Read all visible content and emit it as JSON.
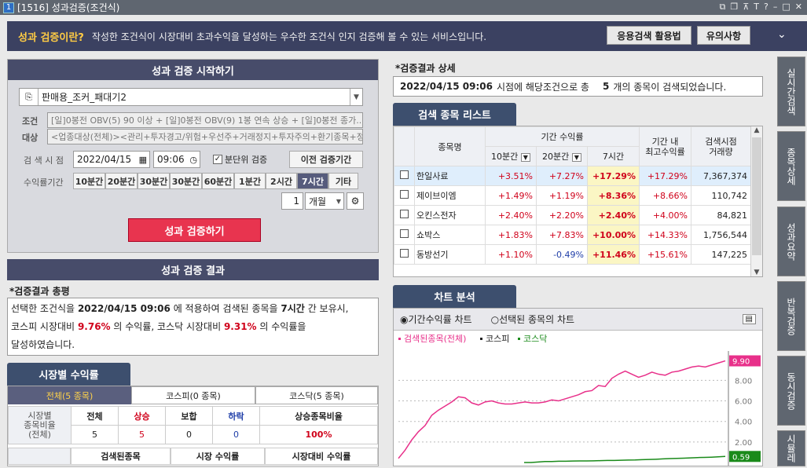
{
  "window": {
    "number": "1",
    "title": "[1516] 성과검증(조건식)"
  },
  "info": {
    "question": "성과 검증이란?",
    "desc": "작성한 조건식이 시장대비 초과수익을 달성하는 우수한 조건식 인지 검증해 볼 수 있는 서비스입니다.",
    "btn_apply": "응용검색 활용법",
    "btn_notes": "유의사항"
  },
  "start": {
    "header": "성과 검증 시작하기",
    "formula": "판매용_조커_패대기2",
    "cond_label1": "조건",
    "cond_label2": "대상",
    "cond_text": "[일]0봉전 OBV(5) 90 이상 + [일]0봉전 OBV(9) 1봉 연속 상승 + [일]0봉전 종가...",
    "target_text": "<업종대상(전체)><관리+투자경고/위험+우선주+거래정지+투자주의+환기종목+정",
    "time_label": "검 색 시 점",
    "date": "2022/04/15",
    "time": "09:06",
    "minute_check": "분단위 검증",
    "prev_btn": "이전 검증기간",
    "period_label": "수익률기간",
    "periods": [
      "10분간",
      "20분간",
      "30분간",
      "30분간",
      "60분간",
      "1분간",
      "2시간",
      "7시간",
      "기타"
    ],
    "count": "1",
    "unit": "개월",
    "run": "성과 검증하기"
  },
  "result": {
    "header": "성과 검증 결과",
    "summary_title": "*검증결과 총평",
    "line1a": "선택한 조건식을",
    "line1b": "2022/04/15 09:06",
    "line1c": "에 적용하여 검색된 종목을",
    "line1d": "7시간",
    "line1e": "간 보유시,",
    "line2a": "코스피 시장대비",
    "line2b": "9.76%",
    "line2c": "의 수익률, 코스닥 시장대비",
    "line2d": "9.31%",
    "line2e": "의 수익률을",
    "line3": "달성하였습니다."
  },
  "market": {
    "tab": "시장별 수익률",
    "subtabs": [
      "전체(5 종목)",
      "코스피(0 종목)",
      "코스닥(5 종목)"
    ],
    "rowlabel": "시장별\n종목비율\n(전체)",
    "headers": [
      "전체",
      "상승",
      "보합",
      "하락",
      "상승종목비율"
    ],
    "values": [
      "5",
      "5",
      "0",
      "0",
      "100%"
    ],
    "headers2": [
      "검색된종목",
      "시장 수익률",
      "시장대비 수익률"
    ]
  },
  "detail": {
    "title": "*검증결과 상세",
    "date": "2022/04/15 09:06",
    "t1": "시점에 해당조건으로 총",
    "count": "5",
    "t2": "개의 종목이 검색되었습니다."
  },
  "list": {
    "tab": "검색 종목 리스트",
    "h_name": "종목명",
    "h_period": "기간 수익률",
    "h_sub": [
      "10분간",
      "20분간",
      "7시간"
    ],
    "h_max": "기간 내\n최고수익률",
    "h_vol": "검색시점\n거래량",
    "rows": [
      {
        "name": "한일사료",
        "a": "+3.51%",
        "b": "+7.27%",
        "c": "+17.29%",
        "max": "+17.29%",
        "vol": "7,367,374"
      },
      {
        "name": "제이브이엠",
        "a": "+1.49%",
        "b": "+1.19%",
        "c": "+8.36%",
        "max": "+8.66%",
        "vol": "110,742"
      },
      {
        "name": "오킨스전자",
        "a": "+2.40%",
        "b": "+2.20%",
        "c": "+2.40%",
        "max": "+4.00%",
        "vol": "84,821"
      },
      {
        "name": "쇼박스",
        "a": "+1.83%",
        "b": "+7.83%",
        "c": "+10.00%",
        "max": "+14.33%",
        "vol": "1,756,544"
      },
      {
        "name": "동방선기",
        "a": "+1.10%",
        "b": "-0.49%",
        "c": "+11.46%",
        "max": "+15.61%",
        "vol": "147,225"
      }
    ]
  },
  "chart": {
    "tab": "차트 분석",
    "radio1": "기간수익률 차트",
    "radio2": "선택된 종목의 차트",
    "legend": [
      "검색된종목(전체)",
      "코스피",
      "코스닥"
    ],
    "colors": {
      "stock": "#e8308a",
      "kospi": "#222222",
      "kosdaq": "#1a8a1a"
    },
    "ticks": [
      "8.00",
      "6.00",
      "4.00",
      "2.00"
    ],
    "last_value": "9.90",
    "kosdaq_last": "0.59"
  },
  "chart_data": {
    "type": "line",
    "ylim": [
      0,
      10.4
    ],
    "yticks": [
      8.0,
      6.0,
      4.0,
      2.0
    ],
    "series": [
      {
        "name": "검색된종목(전체)",
        "values": [
          0.4,
          1.2,
          2.2,
          3.0,
          3.6,
          4.6,
          5.1,
          5.5,
          5.9,
          6.4,
          6.3,
          5.8,
          5.6,
          5.9,
          6.0,
          5.8,
          5.7,
          5.7,
          5.8,
          5.9,
          5.8,
          5.8,
          5.9,
          6.1,
          6.0,
          6.2,
          6.4,
          6.6,
          6.9,
          7.0,
          7.5,
          7.4,
          8.2,
          8.6,
          8.9,
          8.6,
          8.3,
          8.5,
          8.8,
          8.6,
          8.5,
          8.8,
          8.9,
          9.1,
          9.3,
          9.4,
          9.3,
          9.5,
          9.7,
          9.9
        ]
      },
      {
        "name": "코스닥",
        "values": [
          0.0,
          0.0,
          0.05,
          0.1,
          0.1,
          0.12,
          0.12,
          0.14,
          0.15,
          0.15,
          0.16,
          0.18,
          0.2,
          0.2,
          0.22,
          0.24,
          0.25,
          0.28,
          0.3,
          0.32,
          0.35,
          0.38,
          0.4,
          0.42,
          0.45,
          0.48,
          0.5,
          0.52,
          0.55,
          0.59
        ]
      }
    ]
  },
  "side_tabs": [
    "실시간검색",
    "종목상세",
    "성과요약",
    "반복검증",
    "동시검증",
    "시뮬레"
  ]
}
